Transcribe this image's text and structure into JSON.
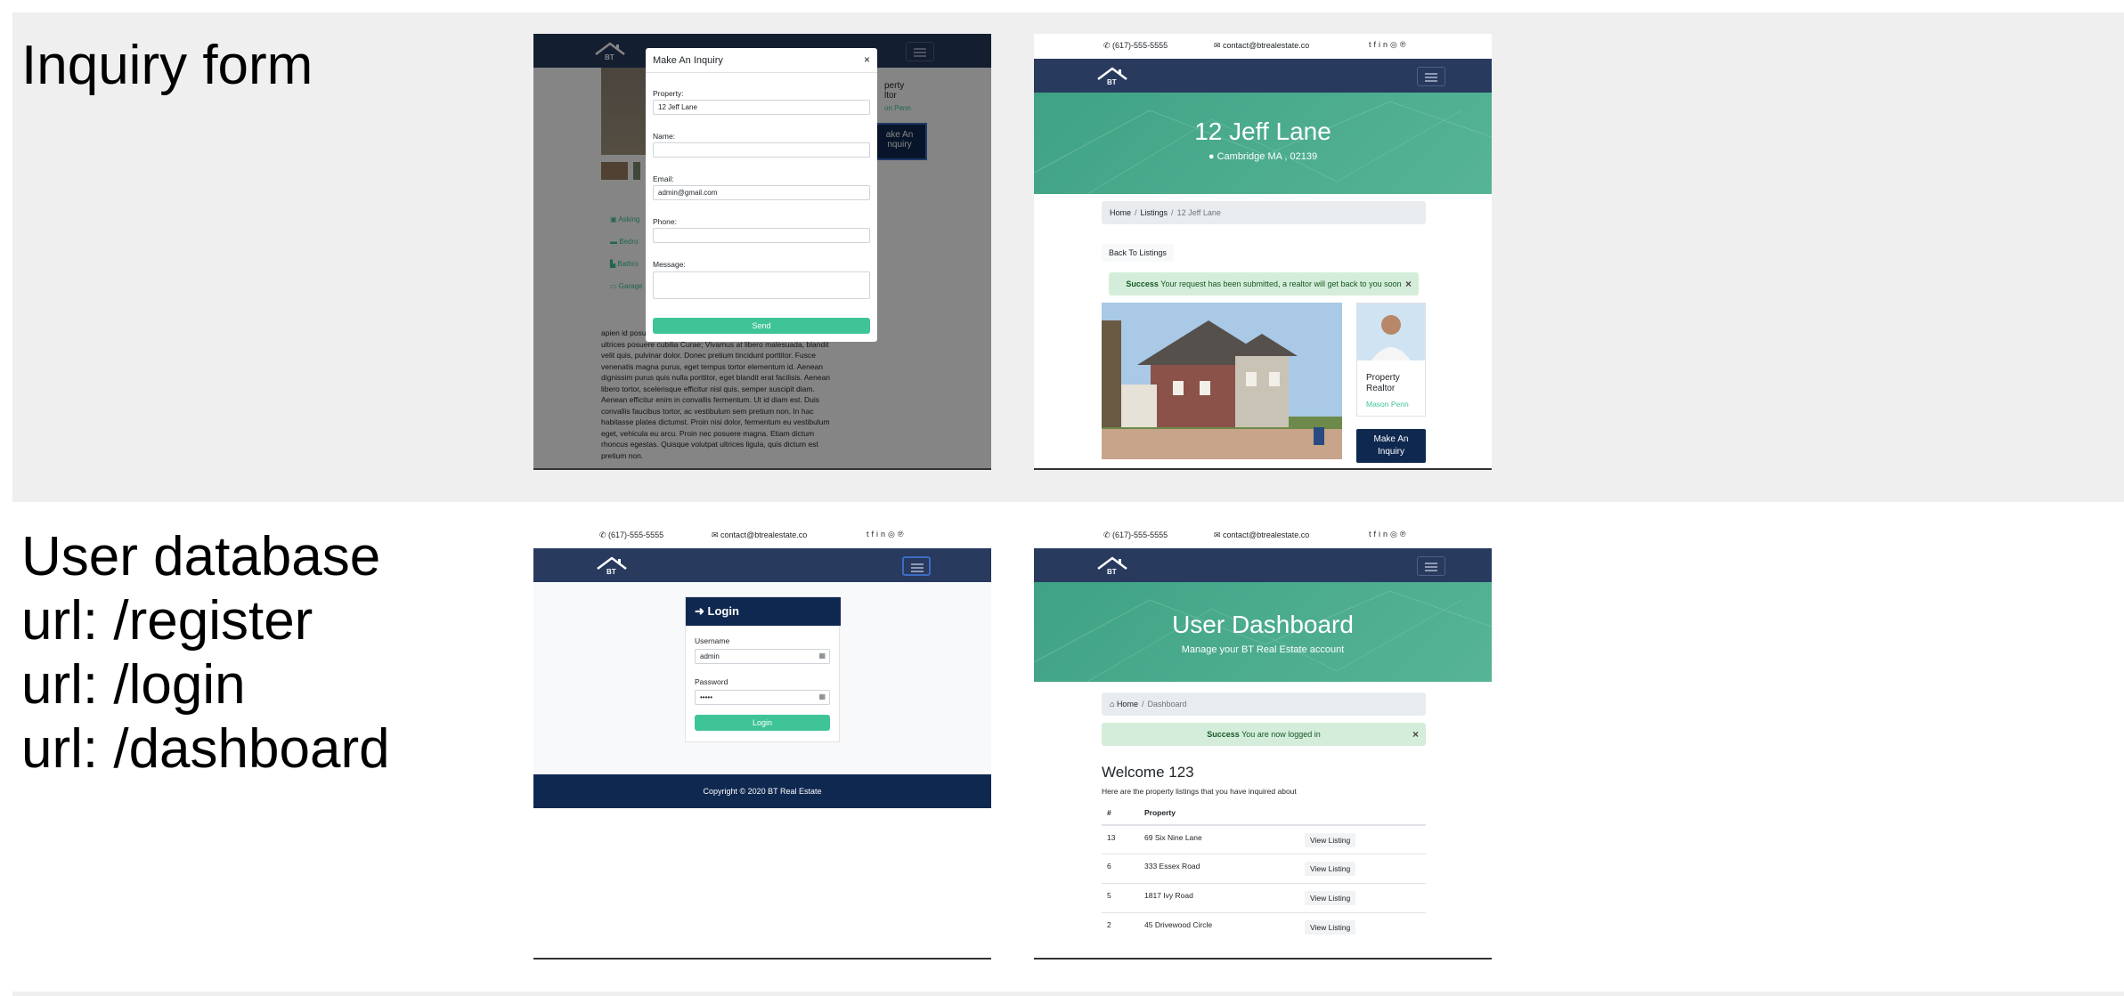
{
  "sections": [
    {
      "label": "Inquiry form"
    },
    {
      "label": "User database\nurl: /register\nurl: /login\nurl: /dashboard"
    }
  ],
  "common": {
    "phone": "(617)-555-5555",
    "email": "contact@btrealestate.co",
    "logo_text": "BT",
    "social_icons": [
      "twitter-icon",
      "facebook-icon",
      "linkedin-icon",
      "instagram-icon",
      "pinterest-icon"
    ]
  },
  "inquiry_modal": {
    "title": "Make An Inquiry",
    "close": "×",
    "property_label": "Property:",
    "property_value": "12 Jeff Lane",
    "name_label": "Name:",
    "name_value": "",
    "email_label": "Email:",
    "email_value": "admin@gmail.com",
    "phone_label": "Phone:",
    "phone_value": "",
    "message_label": "Message:",
    "message_value": "",
    "send_label": "Send",
    "bg_side_text": "perty\nltor",
    "bg_realtor_name": "on Penn",
    "bg_button": "ake An\nnquiry",
    "bg_features": [
      "Asking",
      "Bedro",
      "Bathro",
      "Garage"
    ],
    "bg_paragraph": "apien id posu Vestibulum ante ipsum primis in faucibus orci luctus et ultrices posuere cubilia Curae; Vivamus at libero malesuada, blandit velit quis, pulvinar dolor. Donec pretium tincidunt porttitor. Fusce venenatis magna purus, eget tempus tortor elementum id. Aenean dignissim purus quis nulla porttitor, eget blandit erat facilisis. Aenean libero tortor, scelerisque efficitur nisl quis, semper suscipit diam. Aenean efficitur enim in convallis fermentum. Ut id diam est. Duis convallis faucibus tortor, ac vestibulum sem pretium non. In hac habitasse platea dictumst. Proin nisi dolor, fermentum eu vestibulum eget, vehicula eu arcu. Proin nec posuere magna. Etiam dictum rhoncus egestas. Quisque volutpat ultrices ligula, quis dictum est pretium non."
  },
  "listing_page": {
    "title": "12 Jeff Lane",
    "location": "Cambridge MA , 02139",
    "breadcrumb": [
      "Home",
      "Listings",
      "12 Jeff Lane"
    ],
    "back_button": "Back To Listings",
    "alert_strong": "Success",
    "alert_text": "Your request has been submitted, a realtor will get back to you soon",
    "alert_close": "×",
    "realtor_role": "Property\nRealtor",
    "realtor_name": "Mason Penn",
    "inquiry_button": "Make An\nInquiry"
  },
  "login_page": {
    "title": "Login",
    "username_label": "Username",
    "username_value": "admin",
    "password_label": "Password",
    "password_value": "•••••",
    "button": "Login",
    "footer": "Copyright © 2020 BT Real Estate"
  },
  "dashboard_page": {
    "title": "User Dashboard",
    "subtitle": "Manage your BT Real Estate account",
    "breadcrumb_home": "Home",
    "breadcrumb_current": "Dashboard",
    "alert_strong": "Success",
    "alert_text": "You are now logged in",
    "alert_close": "×",
    "welcome": "Welcome 123",
    "intro": "Here are the property listings that you have inquired about",
    "table_headers": [
      "#",
      "Property"
    ],
    "rows": [
      {
        "id": "13",
        "property": "69 Six Nine Lane",
        "action": "View Listing"
      },
      {
        "id": "6",
        "property": "333 Essex Road",
        "action": "View Listing"
      },
      {
        "id": "5",
        "property": "1817 Ivy Road",
        "action": "View Listing"
      },
      {
        "id": "2",
        "property": "45 Drivewood Circle",
        "action": "View Listing"
      }
    ]
  },
  "colors": {
    "navbar": "#283a5e",
    "footer": "#0f2850",
    "accent_green": "#3fc497",
    "showcase_green": "#3fa285",
    "alert_bg": "#d4edda"
  }
}
